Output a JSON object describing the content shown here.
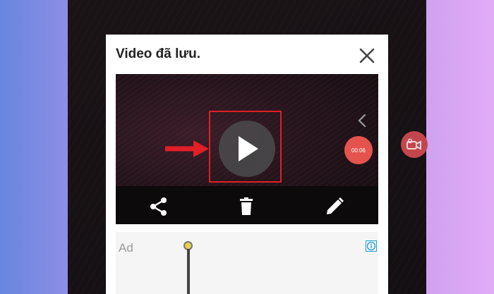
{
  "dialog": {
    "title": "Video đã lưu.",
    "close_icon": "close-icon"
  },
  "video": {
    "timer": "00:06",
    "play_icon": "play-icon",
    "chevron_icon": "chevron-left-icon",
    "actions": [
      {
        "icon": "share-icon"
      },
      {
        "icon": "trash-icon"
      },
      {
        "icon": "pencil-icon"
      }
    ]
  },
  "ad": {
    "label": "Ad",
    "info_icon": "info-icon"
  },
  "annotation": {
    "highlight_color": "#e01f26"
  },
  "colors": {
    "timer_red": "#e5534e",
    "side_record_red": "#c2464d"
  }
}
